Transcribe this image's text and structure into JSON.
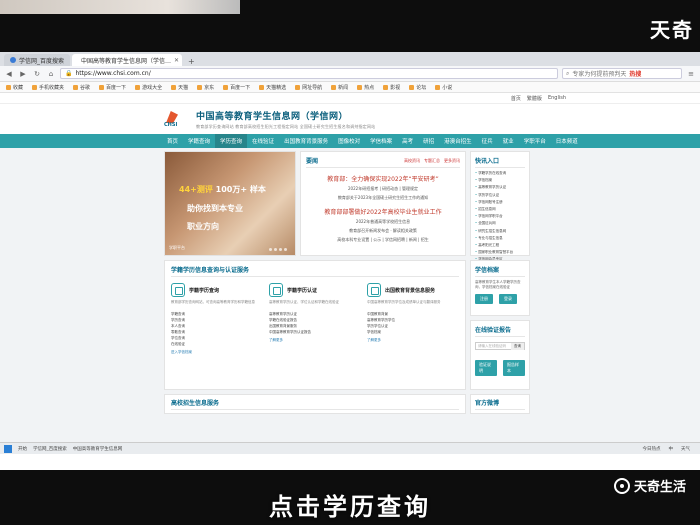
{
  "watermark": {
    "top": "天奇",
    "bottom": "天奇生活"
  },
  "subtitle": "点击学历查询",
  "browser": {
    "tabs": [
      {
        "label": "学信网_百度搜索"
      },
      {
        "label": "中国高等教育学生信息网（学信…"
      }
    ],
    "url": "https://www.chsi.com.cn/",
    "search_placeholder": "专家为何提前预判天",
    "search_hot": "热搜",
    "bookmarks": [
      "收藏",
      "手机收藏夹",
      "谷歌",
      "百度一下",
      "游戏大全",
      "天猫",
      "京东",
      "百度一下",
      "天猫精选",
      "网址导航",
      "新闻",
      "热点",
      "影视",
      "论坛",
      "小说"
    ]
  },
  "page": {
    "top_links": [
      "首页",
      "繁體版",
      "English"
    ],
    "title": "中国高等教育学生信息网（学信网）",
    "subtitle": "教育部学历查询网站  教育部高校招生阳光工程指定网站  全国硕士研究生招生报名和调剂指定网站",
    "logo_text": "CHSI",
    "nav": [
      "首页",
      "学籍查询",
      "学历查询",
      "在线验证",
      "出国教育背景服务",
      "图像校对",
      "学信档案",
      "高考",
      "研招",
      "港澳台招生",
      "征兵",
      "就业",
      "学职平台",
      "日本频道"
    ],
    "banner": {
      "line1_a": "44+测评",
      "line1_b": "100万+",
      "line1_c": "样本",
      "line2": "助你找到本专业",
      "line3": "职业方向",
      "tag": "学职平台"
    },
    "news": {
      "heading": "要闻",
      "more": [
        "高校资讯",
        "专题汇总",
        "更多资讯"
      ],
      "headline1": "教育部：全力确保实现2022年“平安研考”",
      "lines1": [
        "2022年研招报考 | 研招动态 | 管理规定",
        "教育部关于2023年全国硕士研究生招生工作的通知"
      ],
      "headline2": "教育部部署做好2022年高校毕业生就业工作",
      "lines2": [
        "2022年普通高等学校招生信息",
        "教育部召开新闻发布会 · 解读相关政策",
        "高校本科专业设置 | 公示 | 学信网招聘 | 新闻 | 招生"
      ]
    },
    "quick": {
      "heading": "快讯入口",
      "items": [
        "学籍学历在线查询",
        "学信档案",
        "高等教育学历认证",
        "学历学位认证",
        "学信网账号注册",
        "招生信息网",
        "学信网学职平台",
        "全国征兵网",
        "研究生招生信息网",
        "专业与招生信息",
        "高考阳光工程",
        "国家职业教育智慧平台",
        "学信网会员专区",
        "留学服务"
      ]
    },
    "services": {
      "heading": "学籍学历信息查询与认证服务",
      "cols": [
        {
          "title": "学籍学历查询",
          "desc": "教育部学历查询网站，可查询高等教育学历和学籍信息",
          "links": [
            "学籍查询",
            "学历查询",
            "本人查询",
            "零散查询",
            "学位查询",
            "在线验证"
          ],
          "more": "进入学信档案"
        },
        {
          "title": "学籍学历认证",
          "desc": "高等教育学历认证、学位认证和学籍在线验证",
          "links": [
            "高等教育学历认证",
            "学籍在线验证报告",
            "出国教育背景服务",
            "中国高等教育学历认证报告"
          ],
          "more": "了解更多"
        },
        {
          "title": "出国教育背景信息服务",
          "desc": "中国高等教育学历学位及成绩单认证与翻译服务",
          "links": [
            "中国教育背景",
            "高等教育学历学位",
            "学历学位认证",
            "学信档案"
          ],
          "more": "了解更多"
        }
      ]
    },
    "login": {
      "heading": "学信档案",
      "desc": "高等教育学生本人学籍学历查询，学信档案在线验证",
      "register": "注册",
      "login": "登录"
    },
    "verify": {
      "heading": "在线验证报告",
      "placeholder": "请输入在线验证码",
      "button": "查询",
      "btn1": "验证说明",
      "btn2": "报告样本"
    },
    "bottom_left": "高校招生信息服务",
    "bottom_right": "官方微博"
  },
  "taskbar": {
    "items": [
      "开始",
      "学信网_百度搜索",
      "中国高等教育学生信息网"
    ],
    "tray": [
      "今日热点",
      "中",
      "天气"
    ]
  }
}
